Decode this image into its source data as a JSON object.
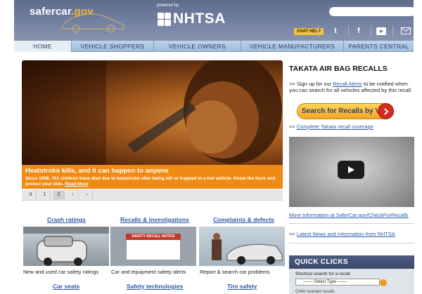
{
  "header": {
    "logo_main": "safercar",
    "logo_suffix": ".gov",
    "powered_by": "powered by",
    "nhtsa": "NHTSA",
    "search": {
      "placeholder": ""
    },
    "chat_help": "CHAT HELP",
    "social_icons": [
      "twitter-icon",
      "facebook-icon",
      "youtube-icon",
      "email-icon"
    ]
  },
  "nav": {
    "items": [
      "HOME",
      "VEHICLE SHOPPERS",
      "VEHICLE OWNERS",
      "VEHICLE MANUFACTURERS",
      "PARENTS  CENTRAL"
    ],
    "active": "HOME"
  },
  "hero": {
    "title": "Heatstroke kills, and it can happen to anyone",
    "description": "Since 1998, 701 children have died due to heatstroke after being left or trapped in a hot vehicle. Know the facts and protect your kids.",
    "read_more": "Read More",
    "pager": [
      "II",
      "1",
      "2",
      "‹",
      "›"
    ],
    "active_page": "2"
  },
  "features": {
    "row1": [
      {
        "link": "Crash ratings",
        "caption": "New and used car safety ratings"
      },
      {
        "link": "Recalls & investigations",
        "caption": "Car and equipment safety alerts"
      },
      {
        "link": "Complaints & defects",
        "caption": "Report & search car problems"
      }
    ],
    "row2": [
      {
        "link": "Car seats"
      },
      {
        "link": "Safety technologies"
      },
      {
        "link": "Tire safety"
      }
    ],
    "recall_notice": "SAFETY RECALL NOTICE"
  },
  "sidebar": {
    "title": "TAKATA AIR BAG RECALLS",
    "signup_prefix": ">> Sign up for our ",
    "signup_link": "Recall Alerts",
    "signup_suffix": " to be notified when you can search for all vehicles affected by this recall.",
    "vin_button": "Search for Recalls by VIN",
    "complete_prefix": ">> ",
    "complete_link": "Complete Takata recall coverage",
    "more_info": "More information at SaferCar.gov/CheckForRecalls",
    "latest_prefix": ">> ",
    "latest_link": "Latest News and Information from NHTSA"
  },
  "quick_clicks": {
    "title": "QUICK CLICKS",
    "label": "Shortcut search for a recall",
    "select_value": "------- Select Type -------",
    "child_restraint": "Child restraint recalls"
  },
  "colors": {
    "header_bg": "#6e7b9a",
    "nav_bg": "#a9c4e0",
    "hero_caption": "#f08a14",
    "link": "#2a5aa8",
    "vin_button": "#f5a623",
    "quick_head": "#3f4d6e"
  }
}
